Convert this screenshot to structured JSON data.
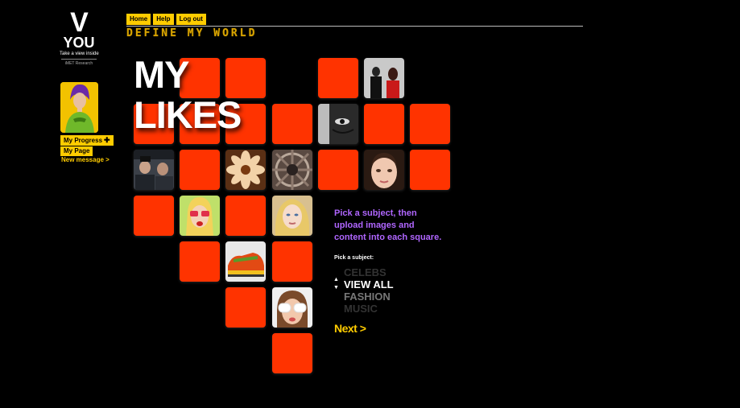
{
  "logo": {
    "mark": "V",
    "name": "YOU",
    "tagline": "Take a view inside",
    "sub": "iMET Research"
  },
  "sidebar": {
    "progress_label": "My Progress",
    "mypage_label": "My Page",
    "new_message": "New message >"
  },
  "nav": {
    "home": "Home",
    "help": "Help",
    "logout": "Log out"
  },
  "page_title": "DEFINE MY WORLD",
  "heading": {
    "line1": "MY",
    "line2": "LIKES"
  },
  "instructions": "Pick a subject, then upload images and content into each square.",
  "pick_label": "Pick a subject:",
  "subjects": {
    "prev": "CELEBS",
    "selected": "VIEW ALL",
    "next": "FASHION",
    "next2": "MUSIC"
  },
  "next_label": "Next >",
  "colors": {
    "accent_yellow": "#ffcc00",
    "tile_red": "#ff3300",
    "purple_text": "#b066ff"
  }
}
